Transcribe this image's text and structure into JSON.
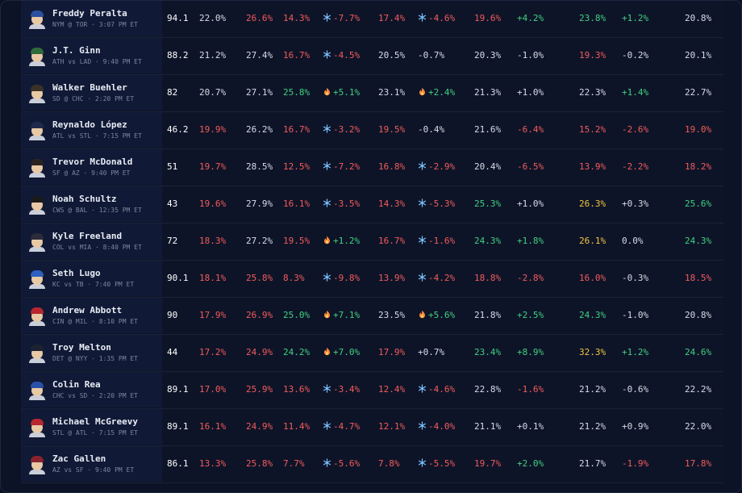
{
  "colors": {
    "red": "#f25b5b",
    "green": "#3fd17f",
    "neutral": "#d7dbe6",
    "yellow": "#f3c640",
    "ice": "#7cc4ff",
    "fire": "#ff8a3a"
  },
  "rows": [
    {
      "name": "Freddy Peralta",
      "game": "NYM @ TOR · 3:07 PM ET",
      "cap": "#2d4fa0",
      "score": "94.1",
      "c1": {
        "v": "22.0%",
        "t": "neutral"
      },
      "c2": {
        "v": "26.6%",
        "t": "red"
      },
      "c3": {
        "v": "14.3%",
        "t": "red"
      },
      "c4": {
        "v": "-7.7%",
        "t": "red",
        "icon": "snowflake-icon"
      },
      "c5": {
        "v": "17.4%",
        "t": "red"
      },
      "c6": {
        "v": "-4.6%",
        "t": "red",
        "icon": "snowflake-icon"
      },
      "c7": {
        "v": "19.6%",
        "t": "red"
      },
      "c8": {
        "v": "+4.2%",
        "t": "green"
      },
      "c9": {
        "v": "23.8%",
        "t": "green"
      },
      "c10": {
        "v": "+1.2%",
        "t": "green"
      },
      "c11": {
        "v": "20.8%",
        "t": "neutral"
      }
    },
    {
      "name": "J.T. Ginn",
      "game": "ATH vs LAD · 9:40 PM ET",
      "cap": "#2f6b3a",
      "score": "88.2",
      "c1": {
        "v": "21.2%",
        "t": "neutral"
      },
      "c2": {
        "v": "27.4%",
        "t": "neutral"
      },
      "c3": {
        "v": "16.7%",
        "t": "red"
      },
      "c4": {
        "v": "-4.5%",
        "t": "red",
        "icon": "snowflake-icon"
      },
      "c5": {
        "v": "20.5%",
        "t": "neutral"
      },
      "c6": {
        "v": "-0.7%",
        "t": "neutral"
      },
      "c7": {
        "v": "20.3%",
        "t": "neutral"
      },
      "c8": {
        "v": "-1.0%",
        "t": "neutral"
      },
      "c9": {
        "v": "19.3%",
        "t": "red"
      },
      "c10": {
        "v": "-0.2%",
        "t": "neutral"
      },
      "c11": {
        "v": "20.1%",
        "t": "neutral"
      }
    },
    {
      "name": "Walker Buehler",
      "game": "SD @ CHC · 2:20 PM ET",
      "cap": "#3b3226",
      "score": "82",
      "c1": {
        "v": "20.7%",
        "t": "neutral"
      },
      "c2": {
        "v": "27.1%",
        "t": "neutral"
      },
      "c3": {
        "v": "25.8%",
        "t": "green"
      },
      "c4": {
        "v": "+5.1%",
        "t": "green",
        "icon": "flame-icon"
      },
      "c5": {
        "v": "23.1%",
        "t": "neutral"
      },
      "c6": {
        "v": "+2.4%",
        "t": "green",
        "icon": "flame-icon"
      },
      "c7": {
        "v": "21.3%",
        "t": "neutral"
      },
      "c8": {
        "v": "+1.0%",
        "t": "neutral"
      },
      "c9": {
        "v": "22.3%",
        "t": "neutral"
      },
      "c10": {
        "v": "+1.4%",
        "t": "green"
      },
      "c11": {
        "v": "22.7%",
        "t": "neutral"
      }
    },
    {
      "name": "Reynaldo López",
      "game": "ATL vs STL · 7:15 PM ET",
      "cap": "#1f2a4a",
      "score": "46.2",
      "c1": {
        "v": "19.9%",
        "t": "red"
      },
      "c2": {
        "v": "26.2%",
        "t": "neutral"
      },
      "c3": {
        "v": "16.7%",
        "t": "red"
      },
      "c4": {
        "v": "-3.2%",
        "t": "red",
        "icon": "snowflake-icon"
      },
      "c5": {
        "v": "19.5%",
        "t": "red"
      },
      "c6": {
        "v": "-0.4%",
        "t": "neutral"
      },
      "c7": {
        "v": "21.6%",
        "t": "neutral"
      },
      "c8": {
        "v": "-6.4%",
        "t": "red"
      },
      "c9": {
        "v": "15.2%",
        "t": "red"
      },
      "c10": {
        "v": "-2.6%",
        "t": "red"
      },
      "c11": {
        "v": "19.0%",
        "t": "red"
      }
    },
    {
      "name": "Trevor McDonald",
      "game": "SF @ AZ · 9:40 PM ET",
      "cap": "#2a2320",
      "score": "51",
      "c1": {
        "v": "19.7%",
        "t": "red"
      },
      "c2": {
        "v": "28.5%",
        "t": "neutral"
      },
      "c3": {
        "v": "12.5%",
        "t": "red"
      },
      "c4": {
        "v": "-7.2%",
        "t": "red",
        "icon": "snowflake-icon"
      },
      "c5": {
        "v": "16.8%",
        "t": "red"
      },
      "c6": {
        "v": "-2.9%",
        "t": "red",
        "icon": "snowflake-icon"
      },
      "c7": {
        "v": "20.4%",
        "t": "neutral"
      },
      "c8": {
        "v": "-6.5%",
        "t": "red"
      },
      "c9": {
        "v": "13.9%",
        "t": "red"
      },
      "c10": {
        "v": "-2.2%",
        "t": "red"
      },
      "c11": {
        "v": "18.2%",
        "t": "red"
      }
    },
    {
      "name": "Noah Schultz",
      "game": "CWS @ BAL · 12:35 PM ET",
      "cap": "#1a1a1a",
      "score": "43",
      "c1": {
        "v": "19.6%",
        "t": "red"
      },
      "c2": {
        "v": "27.9%",
        "t": "neutral"
      },
      "c3": {
        "v": "16.1%",
        "t": "red"
      },
      "c4": {
        "v": "-3.5%",
        "t": "red",
        "icon": "snowflake-icon"
      },
      "c5": {
        "v": "14.3%",
        "t": "red"
      },
      "c6": {
        "v": "-5.3%",
        "t": "red",
        "icon": "snowflake-icon"
      },
      "c7": {
        "v": "25.3%",
        "t": "green"
      },
      "c8": {
        "v": "+1.0%",
        "t": "neutral"
      },
      "c9": {
        "v": "26.3%",
        "t": "yellow"
      },
      "c10": {
        "v": "+0.3%",
        "t": "neutral"
      },
      "c11": {
        "v": "25.6%",
        "t": "green"
      }
    },
    {
      "name": "Kyle Freeland",
      "game": "COL vs MIA · 8:40 PM ET",
      "cap": "#2b2b3a",
      "score": "72",
      "c1": {
        "v": "18.3%",
        "t": "red"
      },
      "c2": {
        "v": "27.2%",
        "t": "neutral"
      },
      "c3": {
        "v": "19.5%",
        "t": "red"
      },
      "c4": {
        "v": "+1.2%",
        "t": "green",
        "icon": "flame-icon"
      },
      "c5": {
        "v": "16.7%",
        "t": "red"
      },
      "c6": {
        "v": "-1.6%",
        "t": "red",
        "icon": "snowflake-icon"
      },
      "c7": {
        "v": "24.3%",
        "t": "green"
      },
      "c8": {
        "v": "+1.8%",
        "t": "green"
      },
      "c9": {
        "v": "26.1%",
        "t": "yellow"
      },
      "c10": {
        "v": "0.0%",
        "t": "neutral"
      },
      "c11": {
        "v": "24.3%",
        "t": "green"
      }
    },
    {
      "name": "Seth Lugo",
      "game": "KC vs TB · 7:40 PM ET",
      "cap": "#2f5fbf",
      "score": "90.1",
      "c1": {
        "v": "18.1%",
        "t": "red"
      },
      "c2": {
        "v": "25.8%",
        "t": "red"
      },
      "c3": {
        "v": "8.3%",
        "t": "red"
      },
      "c4": {
        "v": "-9.8%",
        "t": "red",
        "icon": "snowflake-icon"
      },
      "c5": {
        "v": "13.9%",
        "t": "red"
      },
      "c6": {
        "v": "-4.2%",
        "t": "red",
        "icon": "snowflake-icon"
      },
      "c7": {
        "v": "18.8%",
        "t": "red"
      },
      "c8": {
        "v": "-2.8%",
        "t": "red"
      },
      "c9": {
        "v": "16.0%",
        "t": "red"
      },
      "c10": {
        "v": "-0.3%",
        "t": "neutral"
      },
      "c11": {
        "v": "18.5%",
        "t": "red"
      }
    },
    {
      "name": "Andrew Abbott",
      "game": "CIN @ MIL · 8:10 PM ET",
      "cap": "#b8272f",
      "score": "90",
      "c1": {
        "v": "17.9%",
        "t": "red"
      },
      "c2": {
        "v": "26.9%",
        "t": "red"
      },
      "c3": {
        "v": "25.0%",
        "t": "green"
      },
      "c4": {
        "v": "+7.1%",
        "t": "green",
        "icon": "flame-icon"
      },
      "c5": {
        "v": "23.5%",
        "t": "neutral"
      },
      "c6": {
        "v": "+5.6%",
        "t": "green",
        "icon": "flame-icon"
      },
      "c7": {
        "v": "21.8%",
        "t": "neutral"
      },
      "c8": {
        "v": "+2.5%",
        "t": "green"
      },
      "c9": {
        "v": "24.3%",
        "t": "green"
      },
      "c10": {
        "v": "-1.0%",
        "t": "neutral"
      },
      "c11": {
        "v": "20.8%",
        "t": "neutral"
      }
    },
    {
      "name": "Troy Melton",
      "game": "DET @ NYY · 1:35 PM ET",
      "cap": "#1c2230",
      "score": "44",
      "c1": {
        "v": "17.2%",
        "t": "red"
      },
      "c2": {
        "v": "24.9%",
        "t": "red"
      },
      "c3": {
        "v": "24.2%",
        "t": "green"
      },
      "c4": {
        "v": "+7.0%",
        "t": "green",
        "icon": "flame-icon"
      },
      "c5": {
        "v": "17.9%",
        "t": "red"
      },
      "c6": {
        "v": "+0.7%",
        "t": "neutral"
      },
      "c7": {
        "v": "23.4%",
        "t": "green"
      },
      "c8": {
        "v": "+8.9%",
        "t": "green"
      },
      "c9": {
        "v": "32.3%",
        "t": "yellow"
      },
      "c10": {
        "v": "+1.2%",
        "t": "green"
      },
      "c11": {
        "v": "24.6%",
        "t": "green"
      }
    },
    {
      "name": "Colin Rea",
      "game": "CHC vs SD · 2:20 PM ET",
      "cap": "#2a4fa8",
      "score": "89.1",
      "c1": {
        "v": "17.0%",
        "t": "red"
      },
      "c2": {
        "v": "25.9%",
        "t": "red"
      },
      "c3": {
        "v": "13.6%",
        "t": "red"
      },
      "c4": {
        "v": "-3.4%",
        "t": "red",
        "icon": "snowflake-icon"
      },
      "c5": {
        "v": "12.4%",
        "t": "red"
      },
      "c6": {
        "v": "-4.6%",
        "t": "red",
        "icon": "snowflake-icon"
      },
      "c7": {
        "v": "22.8%",
        "t": "neutral"
      },
      "c8": {
        "v": "-1.6%",
        "t": "red"
      },
      "c9": {
        "v": "21.2%",
        "t": "neutral"
      },
      "c10": {
        "v": "-0.6%",
        "t": "neutral"
      },
      "c11": {
        "v": "22.2%",
        "t": "neutral"
      }
    },
    {
      "name": "Michael McGreevy",
      "game": "STL @ ATL · 7:15 PM ET",
      "cap": "#b8272f",
      "score": "89.1",
      "c1": {
        "v": "16.1%",
        "t": "red"
      },
      "c2": {
        "v": "24.9%",
        "t": "red"
      },
      "c3": {
        "v": "11.4%",
        "t": "red"
      },
      "c4": {
        "v": "-4.7%",
        "t": "red",
        "icon": "snowflake-icon"
      },
      "c5": {
        "v": "12.1%",
        "t": "red"
      },
      "c6": {
        "v": "-4.0%",
        "t": "red",
        "icon": "snowflake-icon"
      },
      "c7": {
        "v": "21.1%",
        "t": "neutral"
      },
      "c8": {
        "v": "+0.1%",
        "t": "neutral"
      },
      "c9": {
        "v": "21.2%",
        "t": "neutral"
      },
      "c10": {
        "v": "+0.9%",
        "t": "neutral"
      },
      "c11": {
        "v": "22.0%",
        "t": "neutral"
      }
    },
    {
      "name": "Zac Gallen",
      "game": "AZ vs SF · 9:40 PM ET",
      "cap": "#8a2330",
      "score": "86.1",
      "c1": {
        "v": "13.3%",
        "t": "red"
      },
      "c2": {
        "v": "25.8%",
        "t": "red"
      },
      "c3": {
        "v": "7.7%",
        "t": "red"
      },
      "c4": {
        "v": "-5.6%",
        "t": "red",
        "icon": "snowflake-icon"
      },
      "c5": {
        "v": "7.8%",
        "t": "red"
      },
      "c6": {
        "v": "-5.5%",
        "t": "red",
        "icon": "snowflake-icon"
      },
      "c7": {
        "v": "19.7%",
        "t": "red"
      },
      "c8": {
        "v": "+2.0%",
        "t": "green"
      },
      "c9": {
        "v": "21.7%",
        "t": "neutral"
      },
      "c10": {
        "v": "-1.9%",
        "t": "red"
      },
      "c11": {
        "v": "17.8%",
        "t": "red"
      }
    }
  ]
}
